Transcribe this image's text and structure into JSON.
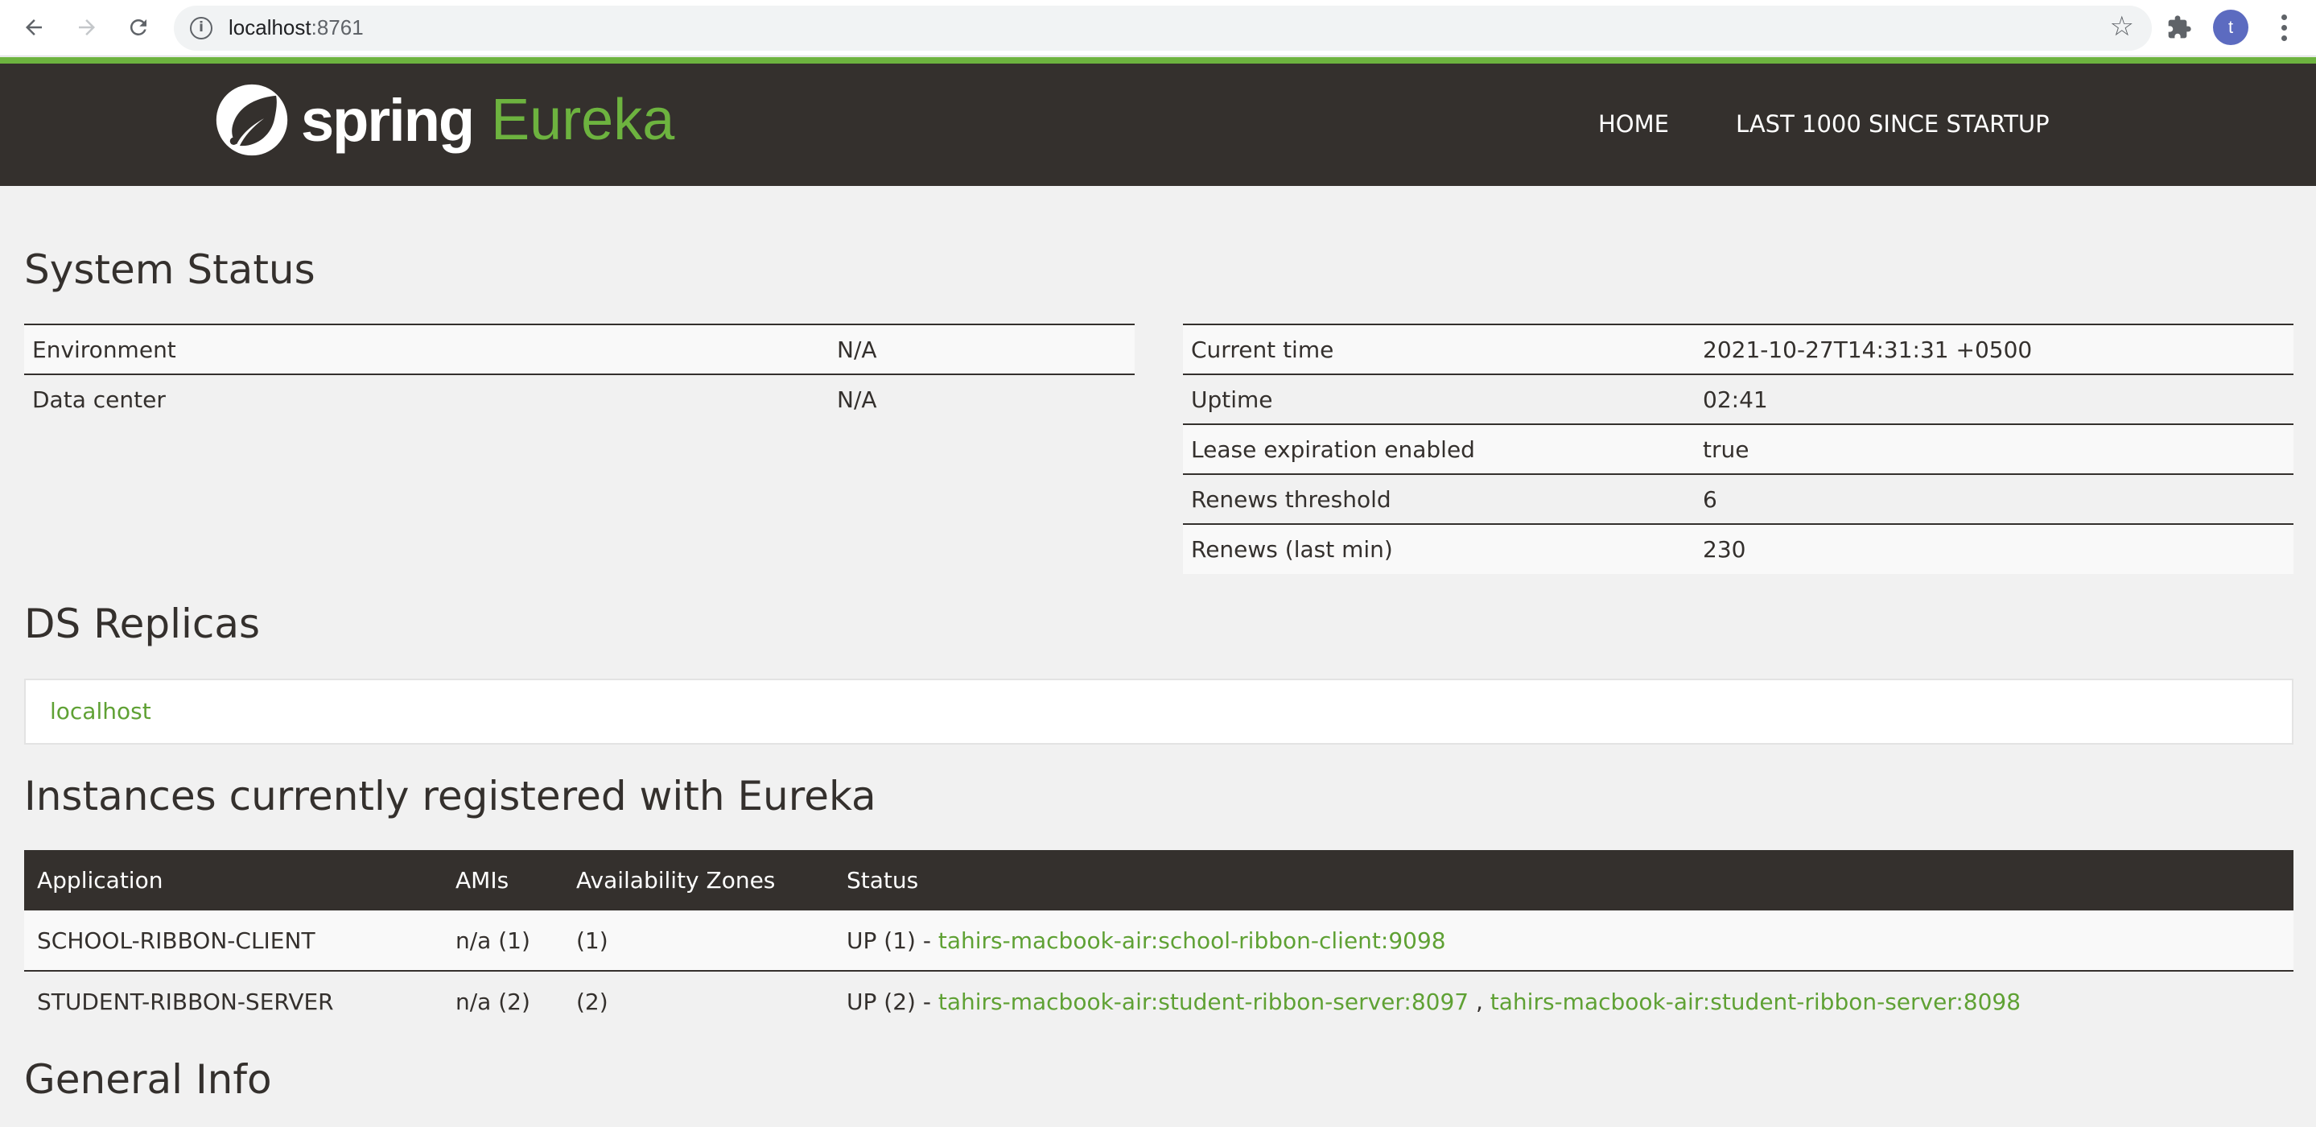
{
  "browser": {
    "url_host": "localhost",
    "url_port": ":8761",
    "avatar_letter": "t",
    "icons": [
      "back-icon",
      "forward-icon",
      "reload-icon",
      "info-icon",
      "star-icon",
      "extensions-icon",
      "avatar",
      "menu-icon"
    ]
  },
  "navbar": {
    "brand_spring": "spring",
    "brand_eureka": "Eureka",
    "links": [
      "HOME",
      "LAST 1000 SINCE STARTUP"
    ],
    "colors": {
      "bar": "#34302d",
      "accent": "#6db33f"
    }
  },
  "system_status": {
    "title": "System Status",
    "left": [
      {
        "key": "Environment",
        "value": "N/A"
      },
      {
        "key": "Data center",
        "value": "N/A"
      }
    ],
    "right": [
      {
        "key": "Current time",
        "value": "2021-10-27T14:31:31 +0500"
      },
      {
        "key": "Uptime",
        "value": "02:41"
      },
      {
        "key": "Lease expiration enabled",
        "value": "true"
      },
      {
        "key": "Renews threshold",
        "value": "6"
      },
      {
        "key": "Renews (last min)",
        "value": "230"
      }
    ]
  },
  "ds_replicas": {
    "title": "DS Replicas",
    "items": [
      "localhost"
    ]
  },
  "instances": {
    "title": "Instances currently registered with Eureka",
    "headers": [
      "Application",
      "AMIs",
      "Availability Zones",
      "Status"
    ],
    "rows": [
      {
        "application": "SCHOOL-RIBBON-CLIENT",
        "amis": "n/a (1)",
        "zones": "(1)",
        "status_prefix": "UP (1) - ",
        "links": [
          "tahirs-macbook-air:school-ribbon-client:9098"
        ]
      },
      {
        "application": "STUDENT-RIBBON-SERVER",
        "amis": "n/a (2)",
        "zones": "(2)",
        "status_prefix": "UP (2) - ",
        "links": [
          "tahirs-macbook-air:student-ribbon-server:8097",
          "tahirs-macbook-air:student-ribbon-server:8098"
        ],
        "separator": " , "
      }
    ]
  },
  "general_info": {
    "title": "General Info"
  }
}
